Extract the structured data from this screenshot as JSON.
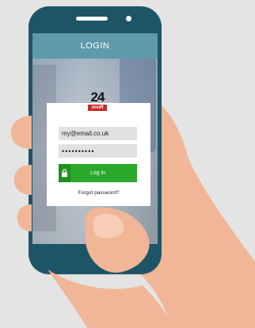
{
  "header": {
    "title": "LOGIN"
  },
  "logo": {
    "number": "24",
    "subtitle": "onoff"
  },
  "form": {
    "email_value": "my@email.co.uk",
    "password_value": "••••••••••",
    "login_label": "Log in",
    "forgot_label": "Forgot password?"
  },
  "icons": {
    "lock": "lock-icon"
  },
  "colors": {
    "phone_body": "#1d5566",
    "header_bar": "#5f9aaa",
    "login_button": "#2aa82a",
    "skin": "#f1b697",
    "background": "#e4e4e4"
  }
}
